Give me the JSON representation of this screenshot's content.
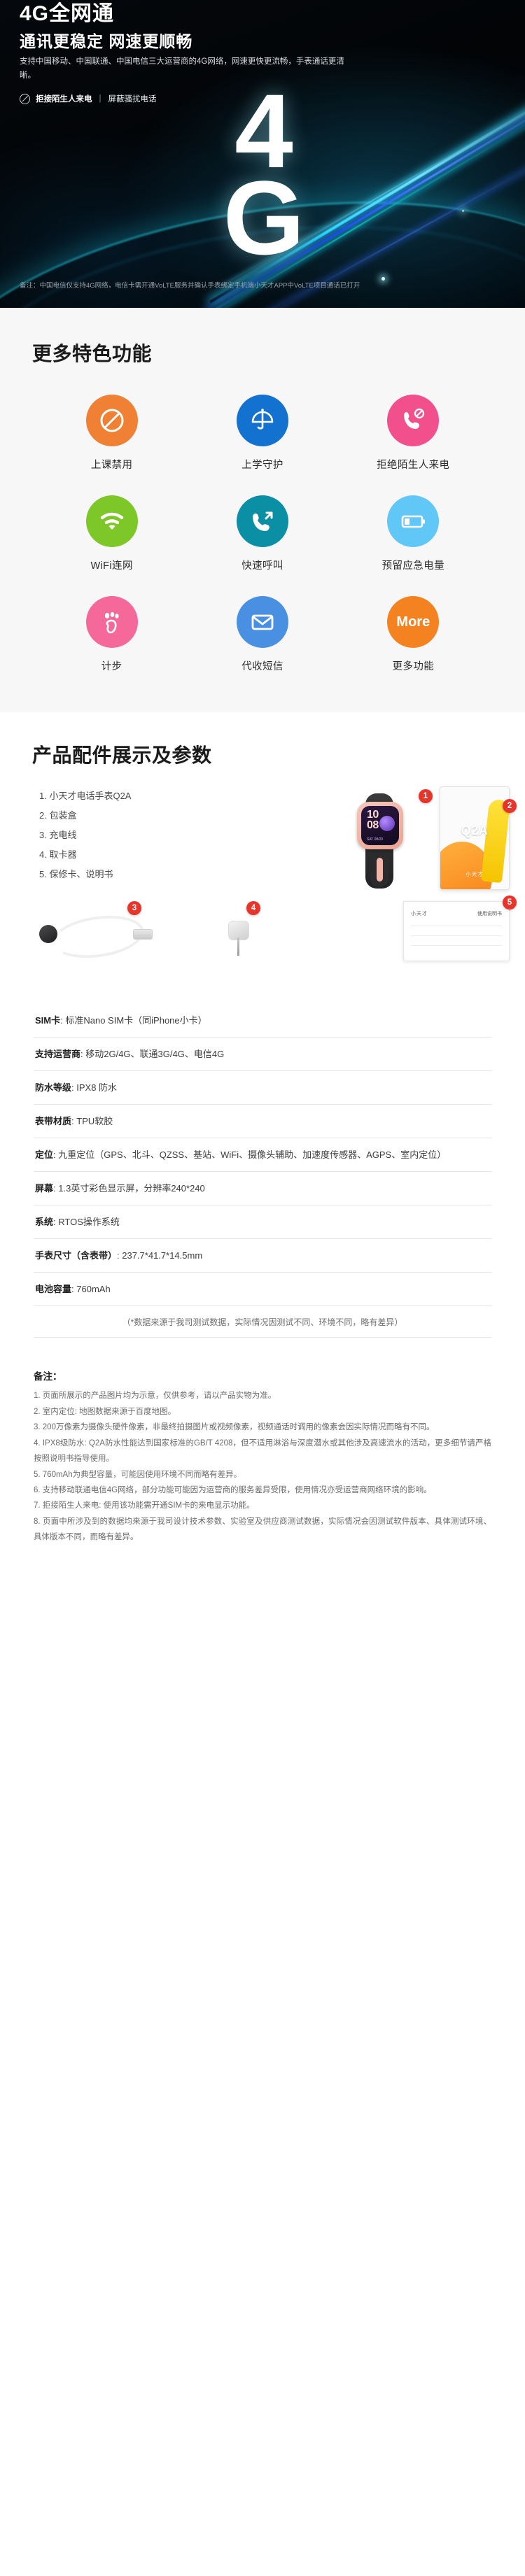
{
  "hero": {
    "title": "4G全网通",
    "subtitle": "通讯更稳定 网速更顺畅",
    "description": "支持中国移动、中国联通、中国电信三大运营商的4G网络，网速更快更流畅，手表通话更清晰。",
    "chip_strong": "拒接陌生人来电",
    "chip_divider": "|",
    "chip_rest": "屏蔽骚扰电话",
    "big_line1": "4",
    "big_line2": "G",
    "note": "备注：中国电信仅支持4G网络，电信卡需开通VoLTE服务并确认手表绑定手机端小天才APP中VoLTE项目通话已打开"
  },
  "features": {
    "title": "更多特色功能",
    "items": [
      {
        "label": "上课禁用",
        "icon": "prohibited-icon",
        "color": "#ef8034"
      },
      {
        "label": "上学守护",
        "icon": "umbrella-icon",
        "color": "#1371d0"
      },
      {
        "label": "拒绝陌生人来电",
        "icon": "call-block-icon",
        "color": "#f2508d"
      },
      {
        "label": "WiFi连网",
        "icon": "wifi-icon",
        "color": "#7ec729"
      },
      {
        "label": "快速呼叫",
        "icon": "call-out-icon",
        "color": "#0a8fa4"
      },
      {
        "label": "预留应急电量",
        "icon": "battery-icon",
        "color": "#61c7f7"
      },
      {
        "label": "计步",
        "icon": "footprint-icon",
        "color": "#f5699a"
      },
      {
        "label": "代收短信",
        "icon": "envelope-icon",
        "color": "#4a90e2"
      },
      {
        "label": "更多功能",
        "icon": "more-icon",
        "color": "#f58220",
        "text": "More"
      }
    ]
  },
  "specs": {
    "title": "产品配件展示及参数",
    "accessories": [
      "1. 小天才电话手表Q2A",
      "2. 包装盒",
      "3. 充电线",
      "4. 取卡器",
      "5. 保修卡、说明书"
    ],
    "badges": [
      "1",
      "2",
      "3",
      "4",
      "5"
    ],
    "box_label": "Q2A",
    "box_brand": "小天才",
    "watch_time": "10\n08",
    "watch_date": "SAT 08/20",
    "manual_left": "小天才",
    "manual_right": "使用说明书",
    "rows": [
      {
        "key": "SIM卡",
        "value": "标准Nano SIM卡（同iPhone小卡）"
      },
      {
        "key": "支持运营商",
        "value": "移动2G/4G、联通3G/4G、电信4G"
      },
      {
        "key": "防水等级",
        "value": "IPX8 防水"
      },
      {
        "key": "表带材质",
        "value": "TPU软胶"
      },
      {
        "key": "定位",
        "value": "九重定位（GPS、北斗、QZSS、基站、WiFi、摄像头辅助、加速度传感器、AGPS、室内定位）"
      },
      {
        "key": "屏幕",
        "value": "1.3英寸彩色显示屏，分辨率240*240"
      },
      {
        "key": "系统",
        "value": "RTOS操作系统"
      },
      {
        "key": "手表尺寸（含表带）",
        "value": "237.7*41.7*14.5mm"
      },
      {
        "key": "电池容量",
        "value": "760mAh"
      }
    ],
    "note": "（*数据来源于我司测试数据，实际情况因测试不同、环境不同，略有差异）"
  },
  "remarks": {
    "title": "备注：",
    "items": [
      "1. 页面所展示的产品图片均为示意，仅供参考，请以产品实物为准。",
      "2. 室内定位: 地图数据来源于百度地图。",
      "3. 200万像素为摄像头硬件像素，非最终拍摄图片或视频像素，视频通话时调用的像素会因实际情况而略有不同。",
      "4. IPX8级防水: Q2A防水性能达到国家标准的GB/T 4208，但不适用淋浴与深度潜水或其他涉及高速流水的活动，更多细节请严格按照说明书指导使用。",
      "5. 760mAh为典型容量，可能因使用环境不同而略有差异。",
      "6. 支持移动联通电信4G网络，部分功能可能因为运营商的服务差异受限，使用情况亦受运营商网络环境的影响。",
      "7. 拒接陌生人来电: 使用该功能需开通SIM卡的来电显示功能。",
      "8. 页面中所涉及到的数据均来源于我司设计技术参数、实验室及供应商测试数据，实际情况会因测试软件版本、具体测试环境、具体版本不同，而略有差异。"
    ]
  }
}
